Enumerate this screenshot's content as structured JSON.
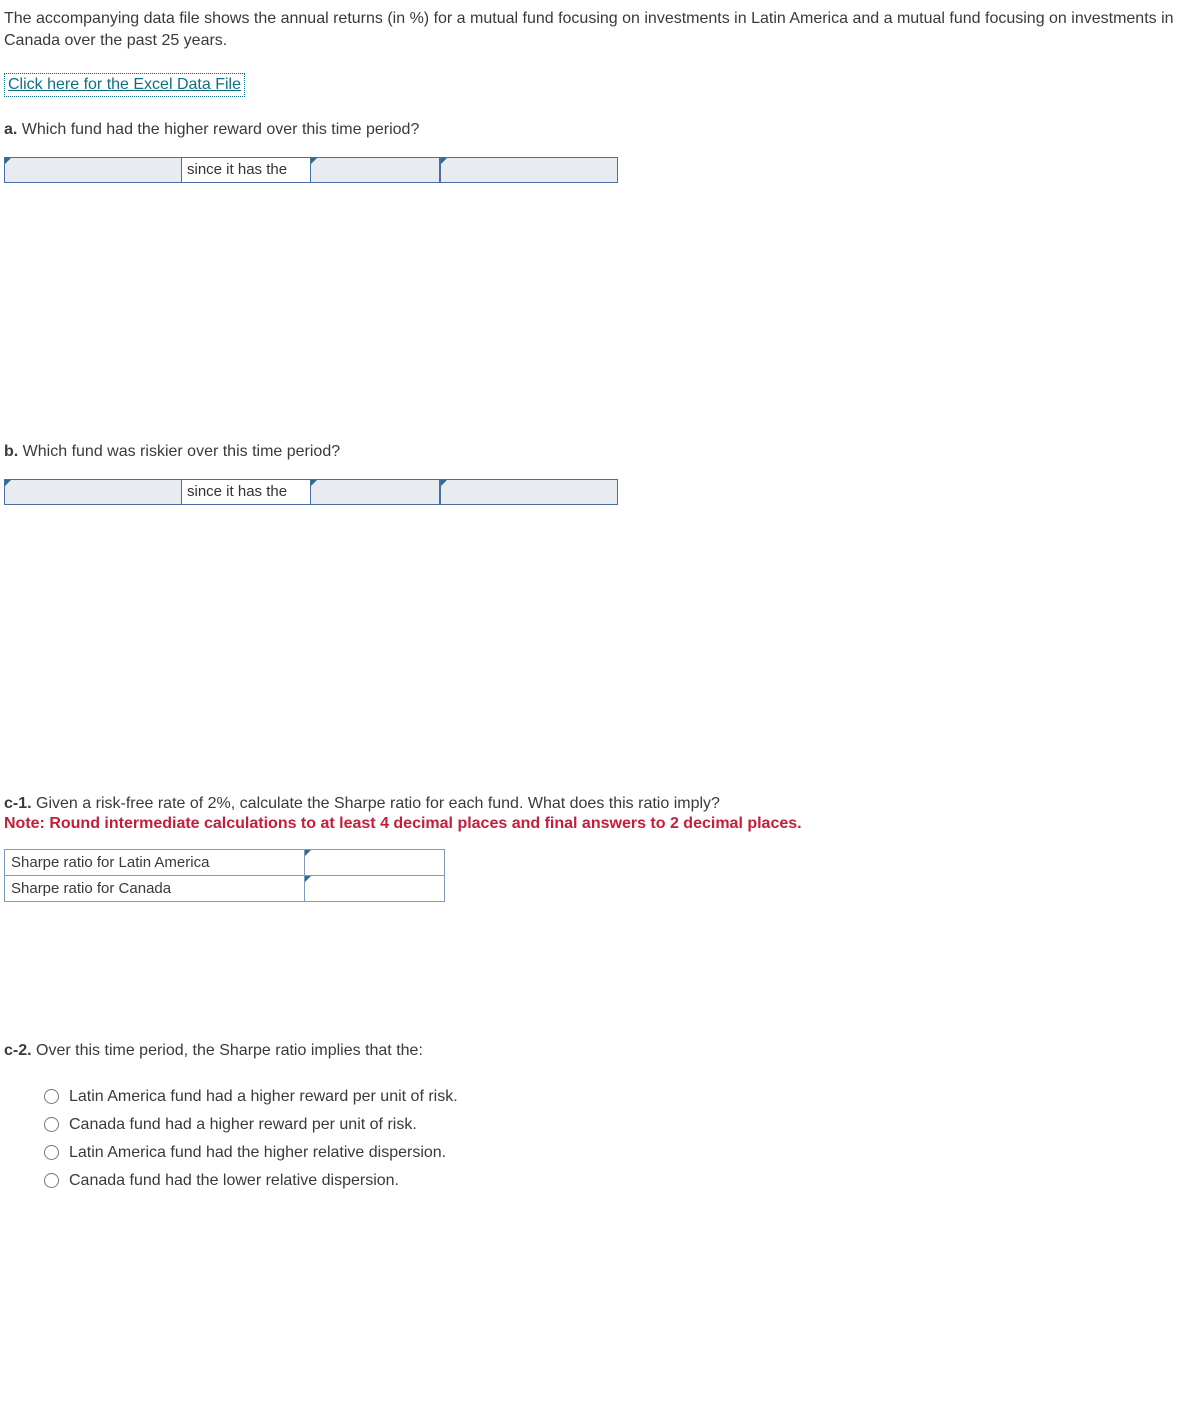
{
  "intro": "The accompanying data file shows the annual returns (in %) for a mutual fund focusing on investments in Latin America and a mutual fund focusing on investments in Canada over the past 25 years.",
  "excel_link": "Click here for the Excel Data File",
  "question_a": {
    "label": "a.",
    "text": "Which fund had the higher reward over this time period?",
    "middle_text": "since it has the"
  },
  "question_b": {
    "label": "b.",
    "text": "Which fund was riskier over this time period?",
    "middle_text": "since it has the"
  },
  "question_c1": {
    "label": "c-1.",
    "text": "Given a risk-free rate of 2%, calculate the Sharpe ratio for each fund. What does this ratio imply?",
    "note": "Note: Round intermediate calculations to at least 4 decimal places and final answers to 2 decimal places.",
    "rows": [
      "Sharpe ratio for Latin America",
      "Sharpe ratio for Canada"
    ]
  },
  "question_c2": {
    "label": "c-2.",
    "text": "Over this time period, the Sharpe ratio implies that the:",
    "options": [
      "Latin America fund had a higher reward per unit of risk.",
      "Canada fund had a higher reward per unit of risk.",
      "Latin America fund had the higher relative dispersion.",
      "Canada fund had the lower relative dispersion."
    ]
  }
}
